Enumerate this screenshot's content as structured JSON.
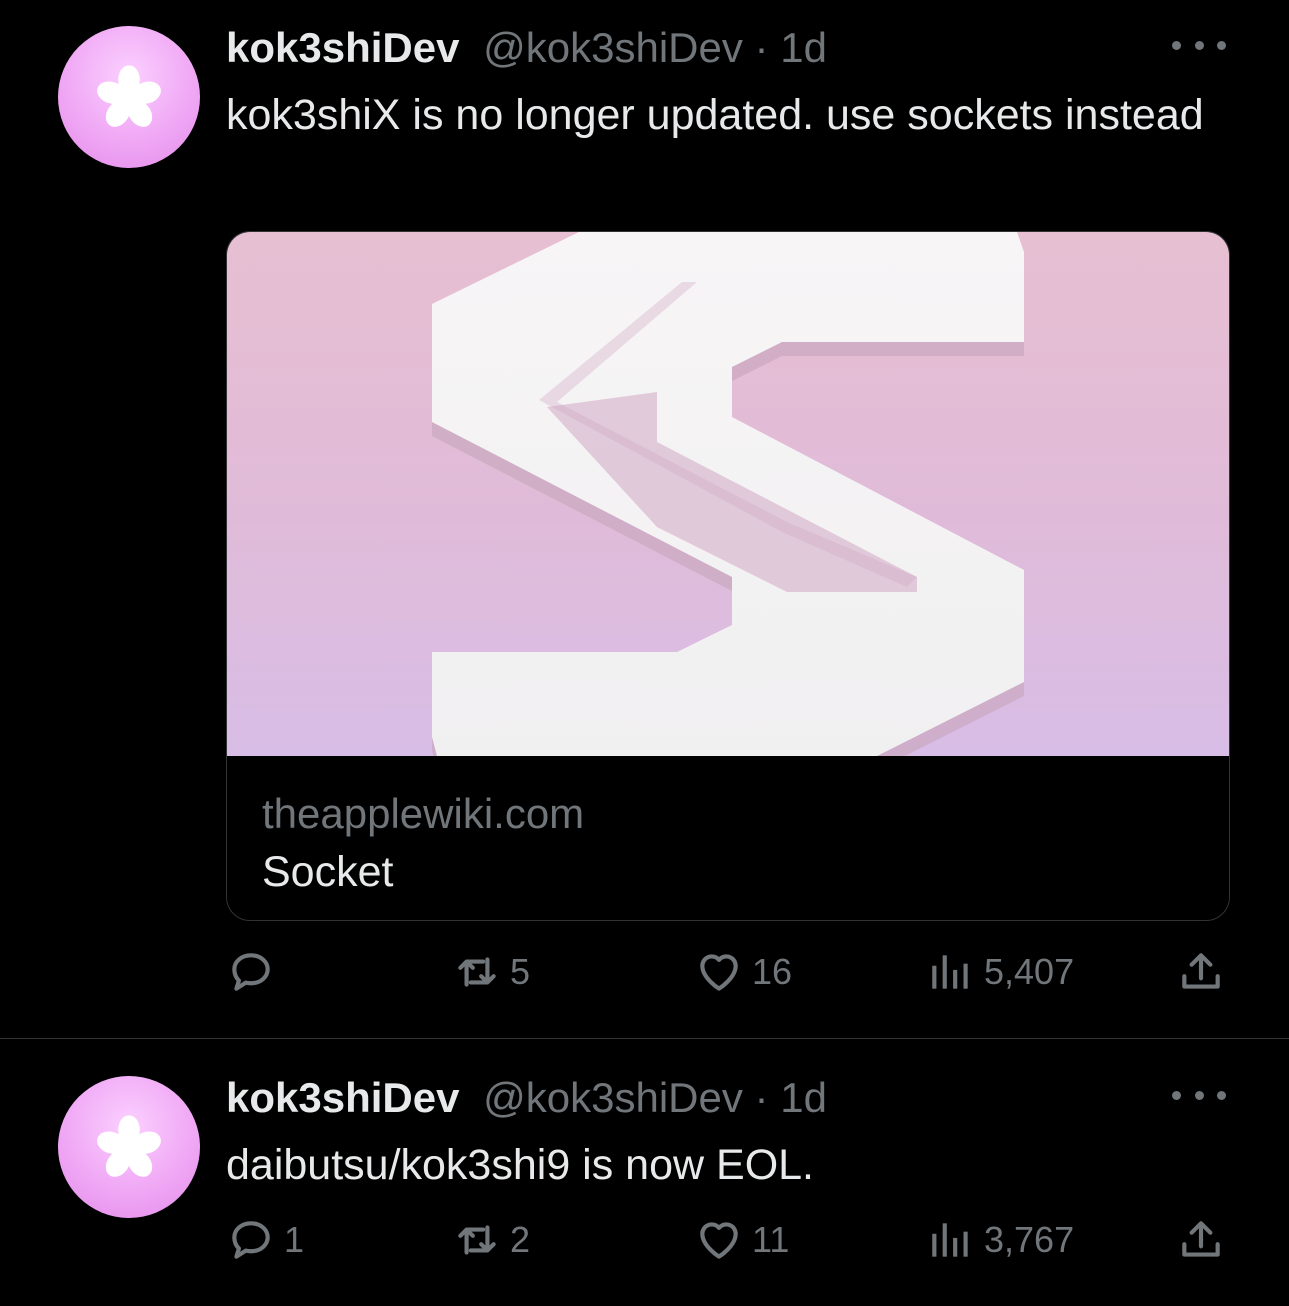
{
  "tweets": [
    {
      "author_name": "kok3shiDev",
      "handle": "@kok3shiDev",
      "separator": "·",
      "time": "1d",
      "text": "kok3shiX is no longer updated.  use sockets instead",
      "card": {
        "domain": "theapplewiki.com",
        "title": "Socket"
      },
      "stats": {
        "replies": "",
        "reposts": "5",
        "likes": "16",
        "views": "5,407"
      }
    },
    {
      "author_name": "kok3shiDev",
      "handle": "@kok3shiDev",
      "separator": "·",
      "time": "1d",
      "text": "daibutsu/kok3shi9 is now EOL.",
      "stats": {
        "replies": "1",
        "reposts": "2",
        "likes": "11",
        "views": "3,767"
      }
    }
  ],
  "icons": {
    "avatar": "sakura-flower-icon",
    "more": "more-horizontal-icon",
    "reply": "reply-icon",
    "repost": "repost-icon",
    "like": "heart-icon",
    "views": "views-bar-icon",
    "share": "share-icon",
    "card_logo": "socket-s-logo"
  },
  "colors": {
    "background": "#000000",
    "text_primary": "#e7e9ea",
    "text_secondary": "#71767b",
    "divider": "#2f3336",
    "avatar_pink": "#f0a8f5",
    "card_pink": "#e0bbd9"
  }
}
